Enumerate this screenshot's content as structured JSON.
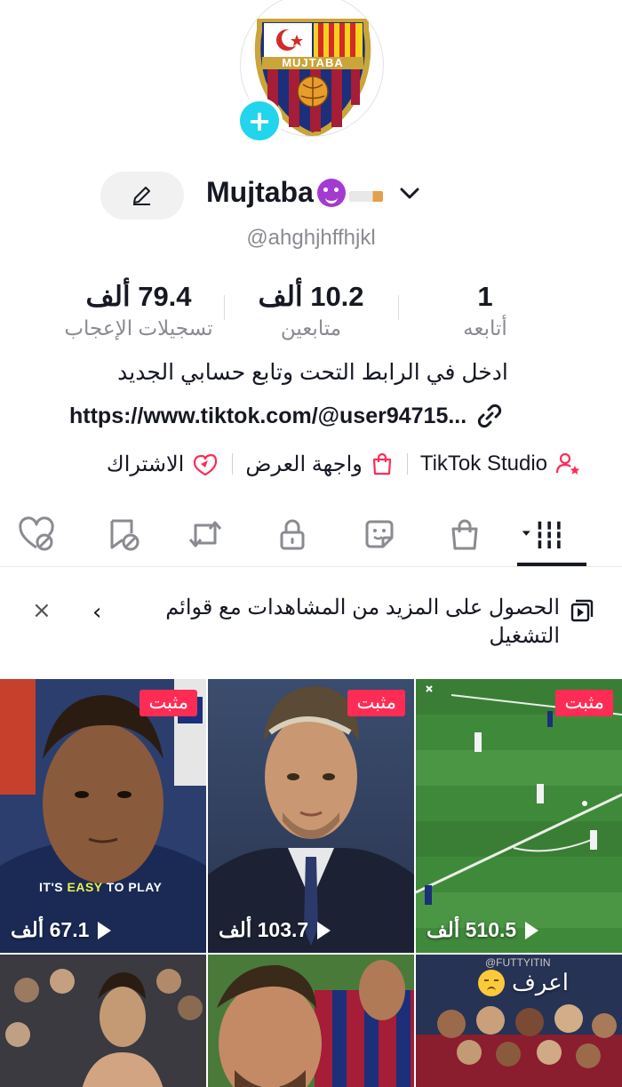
{
  "profile": {
    "display_name": "Mujtaba",
    "username": "@ahghjhffhjkl",
    "crest_text": "MUJTABA",
    "bio": "ادخل في الرابط التحت وتابع حسابي الجديد",
    "link": "https://www.tiktok.com/@user94715..."
  },
  "stats": {
    "likes_value": "79.4 ألف",
    "likes_label": "تسجيلات الإعجاب",
    "followers_value": "10.2 ألف",
    "followers_label": "متابعين",
    "following_value": "1",
    "following_label": "أتابعه"
  },
  "tools": {
    "studio_label": "TikTok Studio",
    "showcase_label": "واجهة العرض",
    "subscription_label": "الاشتراك"
  },
  "tabs": [
    {
      "icon": "grid-videos-icon"
    },
    {
      "icon": "shopping-bag-icon"
    },
    {
      "icon": "sticker-icon"
    },
    {
      "icon": "lock-icon"
    },
    {
      "icon": "repost-icon"
    },
    {
      "icon": "favorites-icon"
    },
    {
      "icon": "liked-icon"
    }
  ],
  "banner": {
    "text": "الحصول على المزيد من المشاهدات مع قوائم التشغيل",
    "chevron": "‹",
    "close": "×"
  },
  "videos": [
    {
      "pinned": "مثبت",
      "views": "510.5 ألف"
    },
    {
      "pinned": "مثبت",
      "views": "103.7 ألف"
    },
    {
      "pinned": "مثبت",
      "views": "67.1 ألف",
      "caption_pre": "IT'S ",
      "caption_easy": "EASY",
      "caption_post": " TO PLAY"
    },
    {
      "caption": "اعرف",
      "watermark": "@FUTTYITIN"
    },
    {},
    {}
  ],
  "colors": {
    "accent": "#fe2c55",
    "add_button": "#20d5ec",
    "muted_text": "#8a8b91"
  }
}
